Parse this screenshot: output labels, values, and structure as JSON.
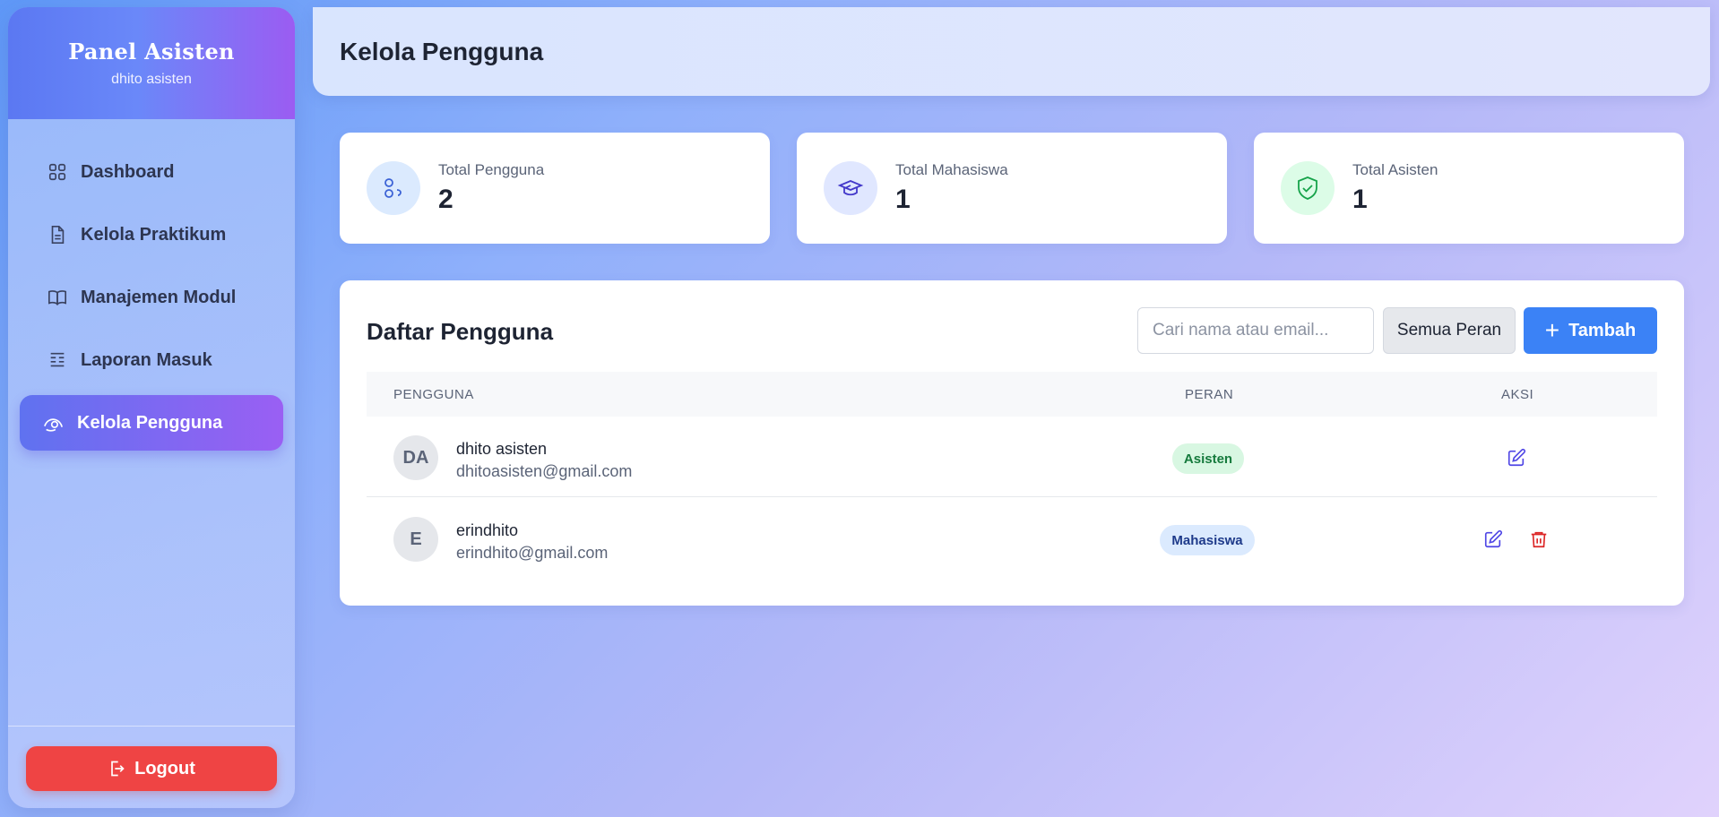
{
  "sidebar": {
    "title": "Panel Asisten",
    "subtitle": "dhito asisten",
    "items": [
      {
        "label": "Dashboard",
        "icon": "grid-icon"
      },
      {
        "label": "Kelola Praktikum",
        "icon": "document-icon"
      },
      {
        "label": "Manajemen Modul",
        "icon": "book-icon"
      },
      {
        "label": "Laporan Masuk",
        "icon": "report-list-icon"
      },
      {
        "label": "Kelola Pengguna",
        "icon": "users-icon",
        "active": true
      }
    ],
    "logout_label": "Logout"
  },
  "header": {
    "title": "Kelola Pengguna"
  },
  "stats": [
    {
      "label": "Total Pengguna",
      "value": "2",
      "icon": "users-icon",
      "color": "#dbeafe"
    },
    {
      "label": "Total Mahasiswa",
      "value": "1",
      "icon": "graduation-cap-icon",
      "color": "#e0e7ff"
    },
    {
      "label": "Total Asisten",
      "value": "1",
      "icon": "shield-check-icon",
      "color": "#dcfce7"
    }
  ],
  "users_panel": {
    "title": "Daftar Pengguna",
    "search_placeholder": "Cari nama atau email...",
    "role_filter": "Semua Peran",
    "add_label": "Tambah",
    "columns": [
      "PENGGUNA",
      "PERAN",
      "AKSI"
    ],
    "rows": [
      {
        "initials": "DA",
        "name": "dhito asisten",
        "email": "dhitoasisten@gmail.com",
        "role": "Asisten",
        "actions": [
          "edit"
        ]
      },
      {
        "initials": "E",
        "name": "erindhito",
        "email": "erindhito@gmail.com",
        "role": "Mahasiswa",
        "actions": [
          "edit",
          "delete"
        ]
      }
    ]
  },
  "colors": {
    "accent": "#3b82f6",
    "danger": "#ef4444",
    "active_nav_start": "#5f72f0",
    "active_nav_end": "#9a5ff3"
  }
}
